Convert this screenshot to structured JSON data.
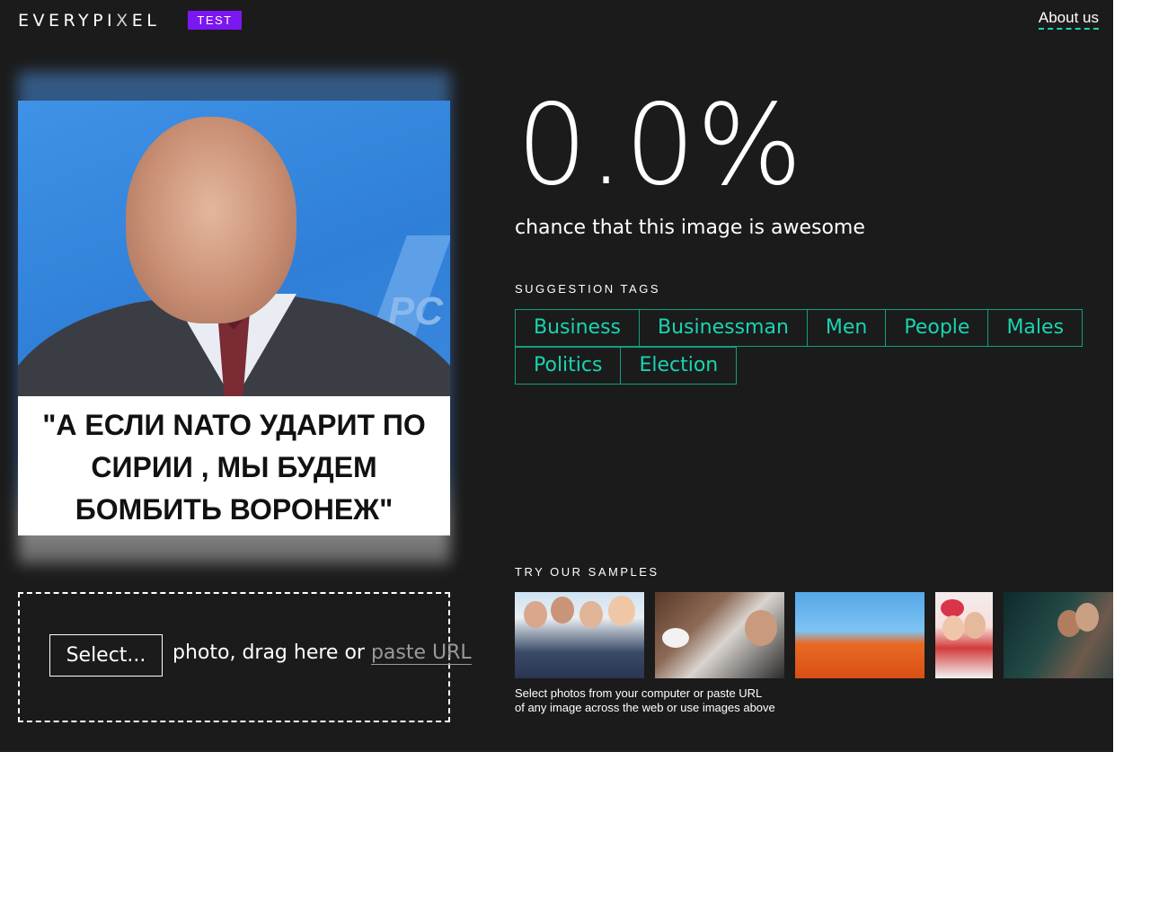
{
  "header": {
    "logo": "EVERYPI",
    "logo_x": "X",
    "logo_end": "EL",
    "badge": "TEST",
    "about": "About us"
  },
  "photo": {
    "caption_lines": [
      "\"А ЕСЛИ NATO УДАРИТ ПО",
      "СИРИИ , МЫ БУДЕМ",
      "БОМБИТЬ ВОРОНЕЖ\""
    ],
    "bg_text": "PC"
  },
  "upload": {
    "select_label": "Select...",
    "drop_text": "photo, drag here or",
    "paste_url": "paste URL"
  },
  "result": {
    "score": "0.0%",
    "subtitle": "chance that this image is awesome"
  },
  "tags": {
    "title": "SUGGESTION TAGS",
    "row1": [
      "Business",
      "Businessman",
      "Men",
      "People",
      "Males"
    ],
    "row2": [
      "Politics",
      "Election"
    ]
  },
  "samples": {
    "title": "TRY OUR SAMPLES",
    "help_line1": "Select photos from your computer or paste URL",
    "help_line2": "of any image across the web or use images above"
  },
  "colors": {
    "background": "#1b1b1b",
    "badge": "#7b17f0",
    "accent": "#19d4b0",
    "tag_border": "#129f83"
  }
}
